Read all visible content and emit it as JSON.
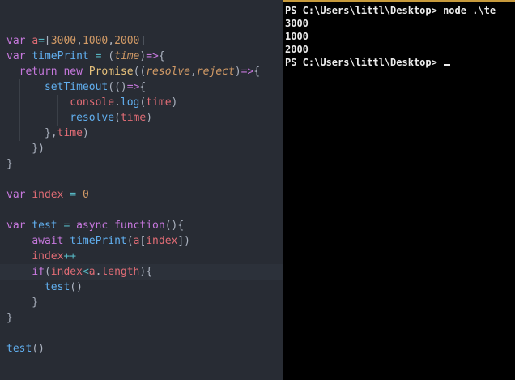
{
  "editor": {
    "lines": [
      [],
      [],
      [
        [
          "kw",
          "var "
        ],
        [
          "var",
          "a"
        ],
        [
          "op",
          "="
        ],
        [
          "pun",
          "["
        ],
        [
          "num",
          "3000"
        ],
        [
          "pun",
          ","
        ],
        [
          "num",
          "1000"
        ],
        [
          "pun",
          ","
        ],
        [
          "num",
          "2000"
        ],
        [
          "pun",
          "]"
        ]
      ],
      [
        [
          "kw",
          "var "
        ],
        [
          "fn",
          "timePrint"
        ],
        [
          "op",
          " = "
        ],
        [
          "pun",
          "("
        ],
        [
          "param",
          "time"
        ],
        [
          "pun",
          ")"
        ],
        [
          "kw",
          "=>"
        ],
        [
          "pun",
          "{"
        ]
      ],
      [
        [
          "kw",
          "  return "
        ],
        [
          "kw",
          "new "
        ],
        [
          "cls",
          "Promise"
        ],
        [
          "pun",
          "(("
        ],
        [
          "param",
          "resolve"
        ],
        [
          "pun",
          ","
        ],
        [
          "param",
          "reject"
        ],
        [
          "pun",
          ")"
        ],
        [
          "kw",
          "=>"
        ],
        [
          "pun",
          "{"
        ]
      ],
      [
        [
          "pun",
          "      "
        ],
        [
          "fn",
          "setTimeout"
        ],
        [
          "pun",
          "(()"
        ],
        [
          "kw",
          "=>"
        ],
        [
          "pun",
          "{"
        ]
      ],
      [
        [
          "pun",
          "          "
        ],
        [
          "var",
          "console"
        ],
        [
          "pun",
          "."
        ],
        [
          "fn",
          "log"
        ],
        [
          "pun",
          "("
        ],
        [
          "var",
          "time"
        ],
        [
          "pun",
          ")"
        ]
      ],
      [
        [
          "pun",
          "          "
        ],
        [
          "fn",
          "resolve"
        ],
        [
          "pun",
          "("
        ],
        [
          "var",
          "time"
        ],
        [
          "pun",
          ")"
        ]
      ],
      [
        [
          "pun",
          "      },"
        ],
        [
          "var",
          "time"
        ],
        [
          "pun",
          ")"
        ]
      ],
      [
        [
          "pun",
          "    })"
        ]
      ],
      [
        [
          "pun",
          "}"
        ]
      ],
      [],
      [
        [
          "kw",
          "var "
        ],
        [
          "var",
          "index"
        ],
        [
          "op",
          " = "
        ],
        [
          "num",
          "0"
        ]
      ],
      [],
      [
        [
          "kw",
          "var "
        ],
        [
          "fn",
          "test"
        ],
        [
          "op",
          " = "
        ],
        [
          "kw",
          "async "
        ],
        [
          "kw",
          "function"
        ],
        [
          "pun",
          "(){"
        ]
      ],
      [
        [
          "pun",
          "    "
        ],
        [
          "kw",
          "await "
        ],
        [
          "fn",
          "timePrint"
        ],
        [
          "pun",
          "("
        ],
        [
          "var",
          "a"
        ],
        [
          "pun",
          "["
        ],
        [
          "var",
          "index"
        ],
        [
          "pun",
          "])"
        ]
      ],
      [
        [
          "pun",
          "    "
        ],
        [
          "var",
          "index"
        ],
        [
          "op",
          "++"
        ]
      ],
      [
        [
          "pun",
          "    "
        ],
        [
          "kw",
          "if"
        ],
        [
          "pun",
          "("
        ],
        [
          "var",
          "index"
        ],
        [
          "op",
          "<"
        ],
        [
          "var",
          "a"
        ],
        [
          "pun",
          "."
        ],
        [
          "var",
          "length"
        ],
        [
          "pun",
          ")"
        ],
        [
          "pun",
          "{"
        ]
      ],
      [
        [
          "pun",
          "      "
        ],
        [
          "fn",
          "test"
        ],
        [
          "pun",
          "()"
        ]
      ],
      [
        [
          "pun",
          "    }"
        ]
      ],
      [
        [
          "pun",
          "}"
        ]
      ],
      [],
      [
        [
          "fn",
          "test"
        ],
        [
          "pun",
          "()"
        ]
      ]
    ],
    "current_line": 17
  },
  "terminal": {
    "lines": [
      "PS C:\\Users\\littl\\Desktop> node .\\te",
      "3000",
      "1000",
      "2000",
      "PS C:\\Users\\littl\\Desktop> "
    ],
    "prompt_line_index": 4
  }
}
